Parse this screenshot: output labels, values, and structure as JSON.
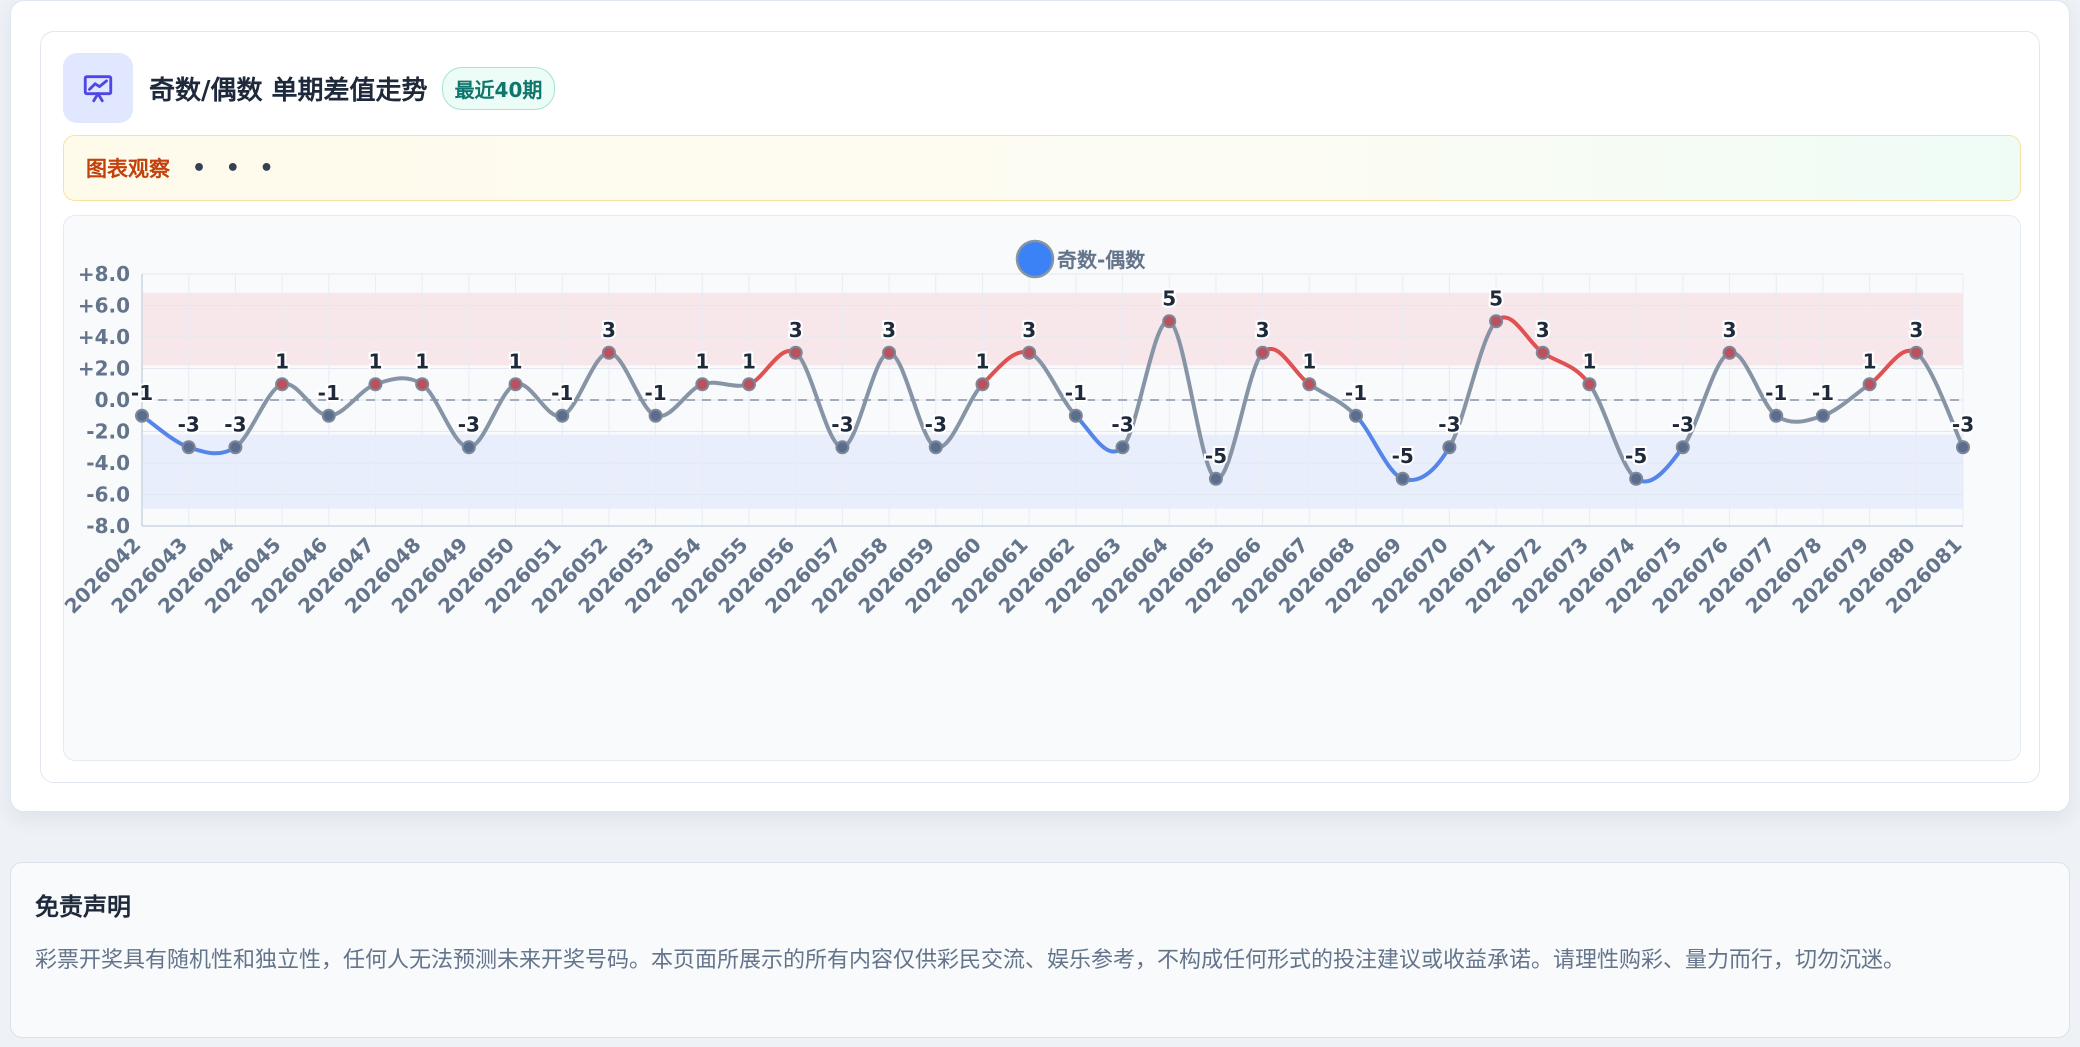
{
  "header": {
    "title": "奇数/偶数 单期差值走势",
    "badge": "最近40期",
    "icon": "presentation-chart-icon"
  },
  "insight": {
    "label": "图表观察",
    "more": "• • •"
  },
  "disclaimer": {
    "title": "免责声明",
    "text": "彩票开奖具有随机性和独立性，任何人无法预测未来开奖号码。本页面所展示的所有内容仅供彩民交流、娱乐参考，不构成任何形式的投注建议或收益承诺。请理性购彩、量力而行，切勿沉迷。"
  },
  "colors": {
    "neutral_line": "#8794a6",
    "positive_line": "#e05252",
    "negative_line": "#5585e8",
    "legend_dot": "#3b82f6",
    "positive_band": "#f8e7ea",
    "negative_band": "#e8eefb"
  },
  "chart_data": {
    "type": "line",
    "legend": [
      "奇数-偶数"
    ],
    "legend_position": "top-center",
    "grid": true,
    "ylim": [
      -8,
      8
    ],
    "yticks": [
      "+8.0",
      "+6.0",
      "+4.0",
      "+2.0",
      "0.0",
      "-2.0",
      "-4.0",
      "-6.0",
      "-8.0"
    ],
    "ytick_values": [
      8,
      6,
      4,
      2,
      0,
      -2,
      -4,
      -6,
      -8
    ],
    "zero_line": 0,
    "positive_band": [
      2.2,
      6.8
    ],
    "negative_band": [
      -2.2,
      -6.9
    ],
    "categories": [
      "2026042",
      "2026043",
      "2026044",
      "2026045",
      "2026046",
      "2026047",
      "2026048",
      "2026049",
      "2026050",
      "2026051",
      "2026052",
      "2026053",
      "2026054",
      "2026055",
      "2026056",
      "2026057",
      "2026058",
      "2026059",
      "2026060",
      "2026061",
      "2026062",
      "2026063",
      "2026064",
      "2026065",
      "2026066",
      "2026067",
      "2026068",
      "2026069",
      "2026070",
      "2026071",
      "2026072",
      "2026073",
      "2026074",
      "2026075",
      "2026076",
      "2026077",
      "2026078",
      "2026079",
      "2026080",
      "2026081"
    ],
    "series": [
      {
        "name": "奇数-偶数",
        "values": [
          -1,
          -3,
          -3,
          1,
          -1,
          1,
          1,
          -3,
          1,
          -1,
          3,
          -1,
          1,
          1,
          3,
          -3,
          3,
          -3,
          1,
          3,
          -1,
          -3,
          5,
          -5,
          3,
          1,
          -1,
          -5,
          -3,
          5,
          3,
          1,
          -5,
          -3,
          3,
          -1,
          -1,
          1,
          3,
          -3
        ],
        "labels": [
          "-1",
          "-3",
          "-3",
          "1",
          "-1",
          "1",
          "1",
          "-3",
          "1",
          "-1",
          "3",
          "-1",
          "1",
          "1",
          "3",
          "-3",
          "3",
          "-3",
          "1",
          "3",
          "-1",
          "-3",
          "5",
          "-5",
          "3",
          "1",
          "-1",
          "-5",
          "-3",
          "5",
          "3",
          "1",
          "-5",
          "-3",
          "3",
          "-1",
          "-1",
          "1",
          "3",
          "-3"
        ]
      }
    ]
  }
}
